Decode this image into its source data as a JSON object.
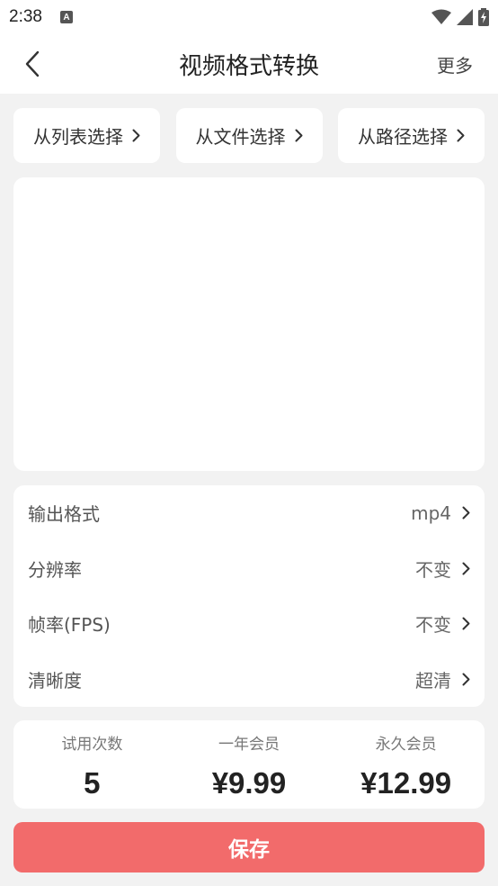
{
  "status_bar": {
    "time": "2:38",
    "notification_letter": "A",
    "icons": [
      "wifi-icon",
      "signal-icon",
      "battery-charging-icon"
    ]
  },
  "app_bar": {
    "title": "视频格式转换",
    "more_label": "更多",
    "back_icon": "chevron-left-icon"
  },
  "source_buttons": [
    {
      "label": "从列表选择"
    },
    {
      "label": "从文件选择"
    },
    {
      "label": "从路径选择"
    }
  ],
  "settings": [
    {
      "label": "输出格式",
      "value": "mp4"
    },
    {
      "label": "分辨率",
      "value": "不变"
    },
    {
      "label": "帧率(FPS)",
      "value": "不变"
    },
    {
      "label": "清晰度",
      "value": "超清"
    }
  ],
  "plans": [
    {
      "label": "试用次数",
      "value": "5"
    },
    {
      "label": "一年会员",
      "value": "¥9.99"
    },
    {
      "label": "永久会员",
      "value": "¥12.99"
    }
  ],
  "save_label": "保存",
  "colors": {
    "accent": "#f26b6b",
    "background": "#f2f2f2",
    "card": "#ffffff"
  }
}
